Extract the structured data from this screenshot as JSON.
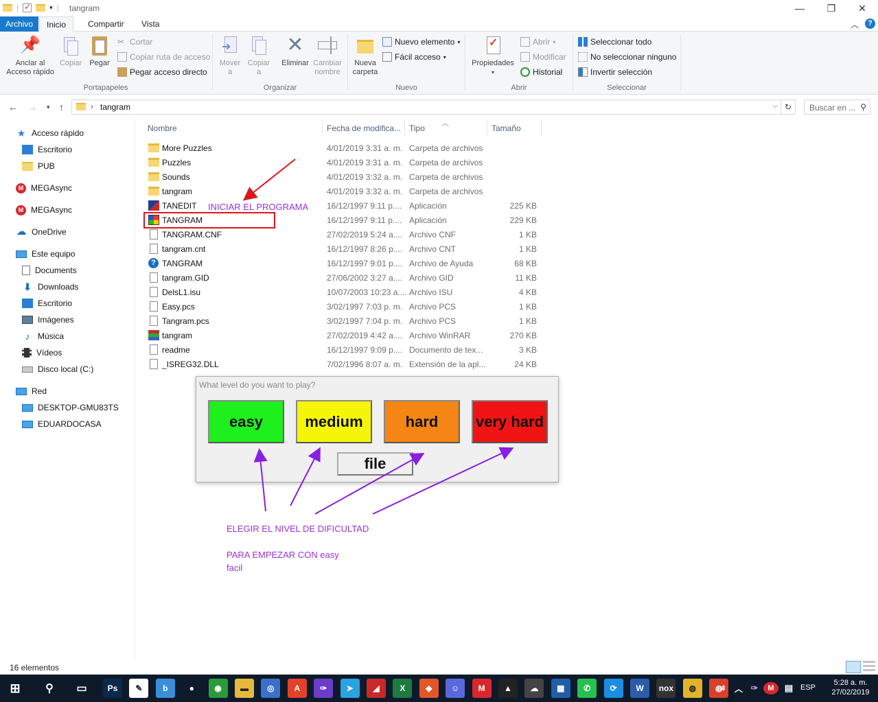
{
  "window": {
    "title": "tangram",
    "controls": [
      "minimize-icon",
      "maximize-icon",
      "close-icon"
    ]
  },
  "ribbon_tabs": [
    "Archivo",
    "Inicio",
    "Compartir",
    "Vista"
  ],
  "ribbon": {
    "portapapeles": {
      "label": "Portapapeles",
      "anclar": "Anclar al\nAcceso rápido",
      "copiar": "Copiar",
      "pegar": "Pegar",
      "cortar": "Cortar",
      "copiar_ruta": "Copiar ruta de acceso",
      "pegar_acceso": "Pegar acceso directo"
    },
    "organizar": {
      "label": "Organizar",
      "mover": "Mover\na",
      "copiar": "Copiar\na",
      "eliminar": "Eliminar",
      "cambiar": "Cambiar\nnombre"
    },
    "nuevo": {
      "label": "Nuevo",
      "nueva_carpeta": "Nueva\ncarpeta",
      "nuevo_elemento": "Nuevo elemento",
      "facil_acceso": "Fácil acceso"
    },
    "abrir": {
      "label": "Abrir",
      "propiedades": "Propiedades",
      "abrir": "Abrir",
      "modificar": "Modificar",
      "historial": "Historial"
    },
    "seleccionar": {
      "label": "Seleccionar",
      "todo": "Seleccionar todo",
      "ninguno": "No seleccionar ninguno",
      "invertir": "Invertir selección"
    }
  },
  "address": {
    "path": "tangram",
    "search_placeholder": "Buscar en ..."
  },
  "nav_pane": [
    {
      "label": "Acceso rápido",
      "icon": "star",
      "indent": 0
    },
    {
      "label": "Escritorio",
      "icon": "blue",
      "indent": 1
    },
    {
      "label": "PUB",
      "icon": "folder",
      "indent": 1
    },
    {
      "label": "MEGAsync",
      "icon": "mega",
      "indent": 0
    },
    {
      "label": "MEGAsync",
      "icon": "mega",
      "indent": 0
    },
    {
      "label": "OneDrive",
      "icon": "cloud",
      "indent": 0
    },
    {
      "label": "Este equipo",
      "icon": "pc",
      "indent": 0
    },
    {
      "label": "Documents",
      "icon": "doc",
      "indent": 1
    },
    {
      "label": "Downloads",
      "icon": "down",
      "indent": 1
    },
    {
      "label": "Escritorio",
      "icon": "blue",
      "indent": 1
    },
    {
      "label": "Imágenes",
      "icon": "img",
      "indent": 1
    },
    {
      "label": "Música",
      "icon": "music",
      "indent": 1
    },
    {
      "label": "Vídeos",
      "icon": "film",
      "indent": 1
    },
    {
      "label": "Disco local (C:)",
      "icon": "drive",
      "indent": 1
    },
    {
      "label": "Red",
      "icon": "net",
      "indent": 0
    },
    {
      "label": "DESKTOP-GMU83TS",
      "icon": "pc",
      "indent": 1
    },
    {
      "label": "EDUARDOCASA",
      "icon": "pc",
      "indent": 1
    }
  ],
  "columns": {
    "name": "Nombre",
    "date": "Fecha de modifica...",
    "type": "Tipo",
    "size": "Tamaño"
  },
  "files": [
    {
      "name": "More Puzzles",
      "date": "4/01/2019 3:31 a. m.",
      "type": "Carpeta de archivos",
      "size": "",
      "icon": "folder"
    },
    {
      "name": "Puzzles",
      "date": "4/01/2019 3:31 a. m.",
      "type": "Carpeta de archivos",
      "size": "",
      "icon": "folder"
    },
    {
      "name": "Sounds",
      "date": "4/01/2019 3:32 a. m.",
      "type": "Carpeta de archivos",
      "size": "",
      "icon": "folder"
    },
    {
      "name": "tangram",
      "date": "4/01/2019 3:32 a. m.",
      "type": "Carpeta de archivos",
      "size": "",
      "icon": "folder"
    },
    {
      "name": "TANEDIT",
      "date": "16/12/1997 9:11 p....",
      "type": "Aplicación",
      "size": "225 KB",
      "icon": "app1"
    },
    {
      "name": "TANGRAM",
      "date": "16/12/1997 9:11 p....",
      "type": "Aplicación",
      "size": "229 KB",
      "icon": "app2"
    },
    {
      "name": "TANGRAM.CNF",
      "date": "27/02/2019 5:24 a....",
      "type": "Archivo CNF",
      "size": "1 KB",
      "icon": "file"
    },
    {
      "name": "tangram.cnt",
      "date": "16/12/1997 8:26 p....",
      "type": "Archivo CNT",
      "size": "1 KB",
      "icon": "file"
    },
    {
      "name": "TANGRAM",
      "date": "16/12/1997 9:01 p....",
      "type": "Archivo de Ayuda",
      "size": "68 KB",
      "icon": "help"
    },
    {
      "name": "tangram.GID",
      "date": "27/06/2002 3:27 a....",
      "type": "Archivo GID",
      "size": "11 KB",
      "icon": "file"
    },
    {
      "name": "DelsL1.isu",
      "date": "10/07/2003 10:23 a....",
      "type": "Archivo ISU",
      "size": "4 KB",
      "icon": "file"
    },
    {
      "name": "Easy.pcs",
      "date": "3/02/1997 7:03 p. m.",
      "type": "Archivo PCS",
      "size": "1 KB",
      "icon": "file"
    },
    {
      "name": "Tangram.pcs",
      "date": "3/02/1997 7:04 p. m.",
      "type": "Archivo PCS",
      "size": "1 KB",
      "icon": "file"
    },
    {
      "name": "tangram",
      "date": "27/02/2019 4:42 a....",
      "type": "Archivo WinRAR",
      "size": "270 KB",
      "icon": "rar"
    },
    {
      "name": "readme",
      "date": "16/12/1997 9:09 p....",
      "type": "Documento de tex...",
      "size": "3 KB",
      "icon": "file"
    },
    {
      "name": "_ISREG32.DLL",
      "date": "7/02/1996 8:07 a. m.",
      "type": "Extensión de la apl...",
      "size": "24 KB",
      "icon": "dll"
    }
  ],
  "annotations": {
    "iniciar": "INICIAR EL PROGRAMA",
    "elegir": "ELEGIR EL NIVEL DE DIFICULTAD",
    "empezar": "PARA EMPEZAR CON easy",
    "facil": "facil",
    "color": "#9b30d9",
    "highlight_color": "#e0141e"
  },
  "dialog": {
    "title": "What level do you want to play?",
    "levels": [
      {
        "label": "easy",
        "color": "#1ef01e"
      },
      {
        "label": "medium",
        "color": "#f5f50a"
      },
      {
        "label": "hard",
        "color": "#f58514"
      },
      {
        "label": "very hard",
        "color": "#f01414"
      }
    ],
    "file_label": "file"
  },
  "status": {
    "count": "16 elementos"
  },
  "taskbar": {
    "apps": [
      {
        "name": "photoshop-icon",
        "text": "Ps",
        "color": "#0b2a4a"
      },
      {
        "name": "app2-icon",
        "text": "✎",
        "color": "#fff"
      },
      {
        "name": "app3-icon",
        "text": "b",
        "color": "#3a8fd8"
      },
      {
        "name": "app4-icon",
        "text": "●",
        "color": "#0e1a2a"
      },
      {
        "name": "app5-icon",
        "text": "◉",
        "color": "#2c9a3a"
      },
      {
        "name": "explorer-icon",
        "text": "▬",
        "color": "#e6b93e"
      },
      {
        "name": "app7-icon",
        "text": "◎",
        "color": "#3a70c8"
      },
      {
        "name": "app8-icon",
        "text": "A",
        "color": "#e2412a"
      },
      {
        "name": "app9-icon",
        "text": "✑",
        "color": "#6a3dc8"
      },
      {
        "name": "telegram-icon",
        "text": "➤",
        "color": "#2aa3e0"
      },
      {
        "name": "app11-icon",
        "text": "◢",
        "color": "#c82a2a"
      },
      {
        "name": "excel-icon",
        "text": "X",
        "color": "#1e7a3f"
      },
      {
        "name": "app13-icon",
        "text": "◆",
        "color": "#e2562a"
      },
      {
        "name": "discord-icon",
        "text": "☺",
        "color": "#5a68e0"
      },
      {
        "name": "mega-icon",
        "text": "M",
        "color": "#d9272e"
      },
      {
        "name": "app16-icon",
        "text": "▲",
        "color": "#222"
      },
      {
        "name": "app17-icon",
        "text": "☁",
        "color": "#444"
      },
      {
        "name": "app18-icon",
        "text": "▦",
        "color": "#1f5fa8"
      },
      {
        "name": "whatsapp-icon",
        "text": "✆",
        "color": "#25c04e"
      },
      {
        "name": "app20-icon",
        "text": "⟳",
        "color": "#1a8fe0"
      },
      {
        "name": "word-icon",
        "text": "W",
        "color": "#2a5caa"
      },
      {
        "name": "nox-icon",
        "text": "nox",
        "color": "#333"
      },
      {
        "name": "chrome-icon",
        "text": "◍",
        "color": "#e2b32a"
      },
      {
        "name": "chrome2-icon",
        "text": "◍",
        "color": "#d8402a"
      }
    ],
    "lang": "ESP",
    "time": "5:28 a. m.",
    "date": "27/02/2019"
  }
}
